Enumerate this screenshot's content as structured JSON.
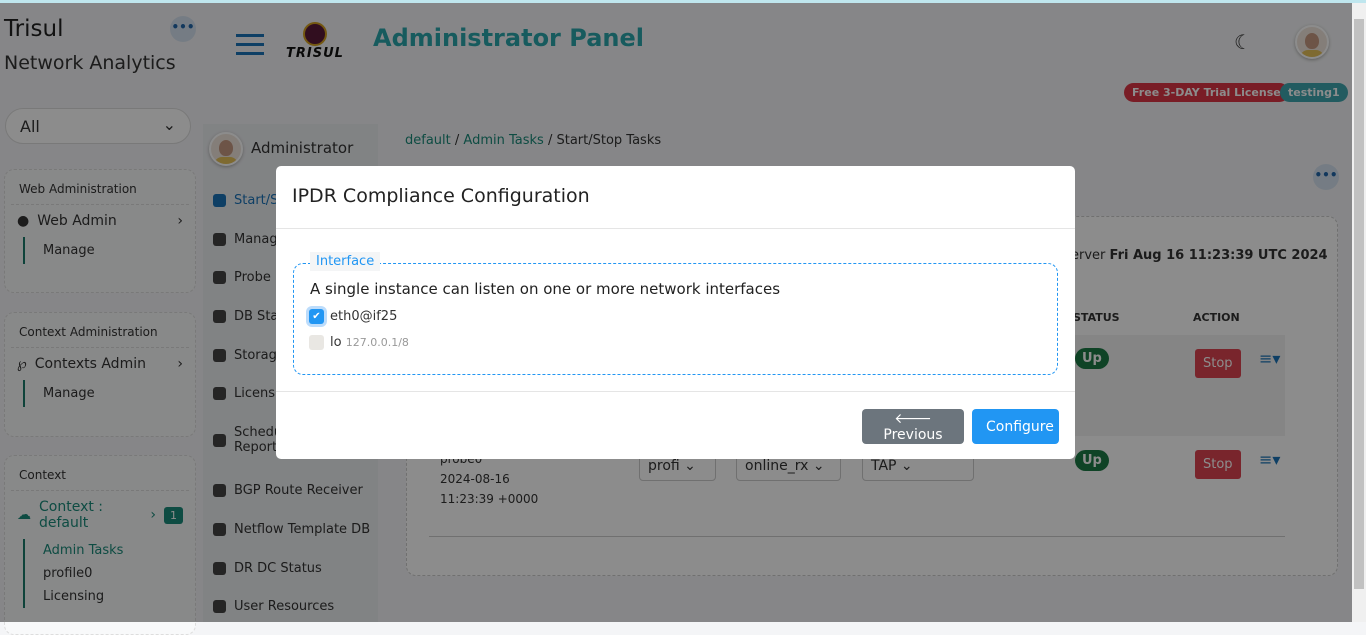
{
  "brand": {
    "name": "Trisul",
    "subtitle": "Network Analytics",
    "logo_text": "TRISUL"
  },
  "header": {
    "title": "Administrator Panel",
    "license_badge": "Free 3-DAY Trial License",
    "user_badge": "testing1"
  },
  "colors": {
    "accent": "#2aa6ac",
    "primary": "#2196f3",
    "danger": "#dc4450",
    "success": "#1d7a45"
  },
  "sidebar": {
    "filter": "All",
    "web_admin": {
      "heading": "Web Administration",
      "item": "Web Admin",
      "sub": "Manage"
    },
    "context_admin": {
      "heading": "Context Administration",
      "item": "Contexts Admin",
      "sub": "Manage"
    },
    "context": {
      "heading": "Context",
      "item": "Context : default",
      "count": "1",
      "subs": [
        "Admin Tasks",
        "profile0",
        "Licensing"
      ]
    }
  },
  "admin_menu": {
    "user": "Administrator",
    "items": [
      "Start/S",
      "Manage",
      "Probe H",
      "DB Stat",
      "Storage",
      "Licensin",
      "Schedu",
      "Reports",
      "BGP Route Receiver",
      "Netflow Template DB",
      "DR DC Status",
      "User Resources"
    ]
  },
  "breadcrumb": [
    "default",
    "Admin Tasks",
    "Start/Stop Tasks"
  ],
  "main": {
    "server_label": "erver",
    "server_time": "Fri Aug 16 11:23:39 UTC 2024",
    "columns": {
      "status": "STATUS",
      "action": "ACTION"
    },
    "rows": [
      {
        "status": "Up",
        "action": "Stop"
      },
      {
        "name": "probe0",
        "date": "2024-08-16",
        "time": "11:23:39 +0000",
        "profile": "profi",
        "mode": "online_rx",
        "type": "TAP",
        "status": "Up",
        "action": "Stop"
      }
    ]
  },
  "modal": {
    "title": "IPDR Compliance Configuration",
    "legend": "Interface",
    "description": "A single instance can listen on one or more network interfaces",
    "interfaces": [
      {
        "name": "eth0@if25",
        "detail": "",
        "checked": true
      },
      {
        "name": "lo",
        "detail": "127.0.0.1/8",
        "checked": false
      }
    ],
    "previous": "Previous",
    "configure": "Configure"
  }
}
